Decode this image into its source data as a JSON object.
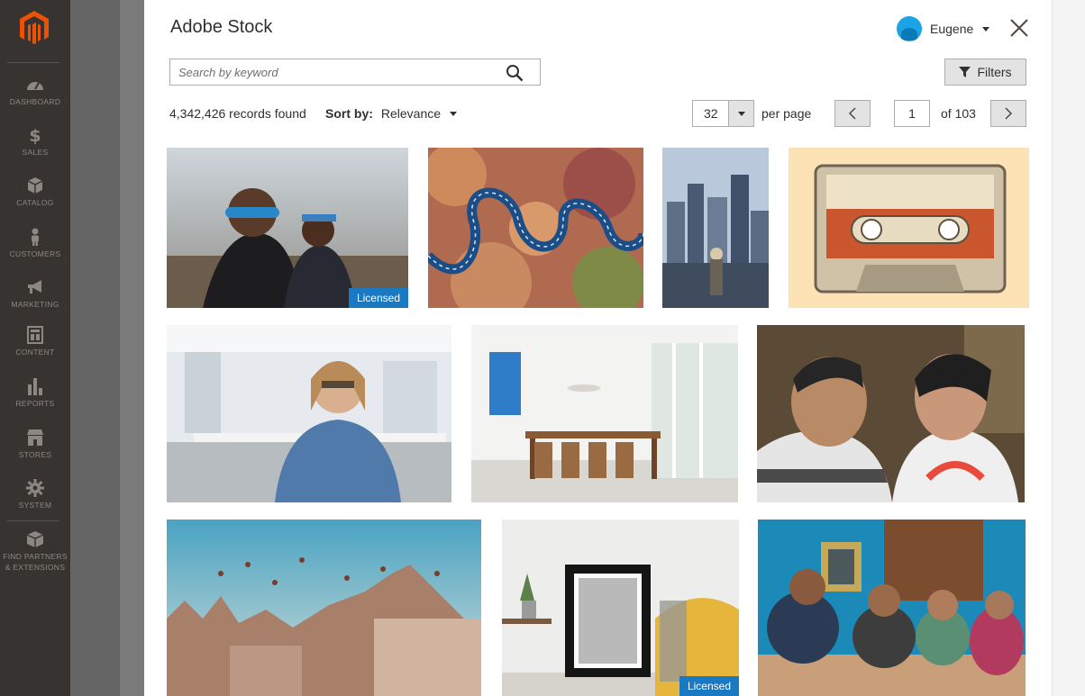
{
  "admin_nav": {
    "items": [
      {
        "label": "DASHBOARD",
        "icon": "dashboard-icon"
      },
      {
        "label": "SALES",
        "icon": "dollar-icon"
      },
      {
        "label": "CATALOG",
        "icon": "box-icon"
      },
      {
        "label": "CUSTOMERS",
        "icon": "person-icon"
      },
      {
        "label": "MARKETING",
        "icon": "megaphone-icon"
      },
      {
        "label": "CONTENT",
        "icon": "layout-icon"
      },
      {
        "label": "REPORTS",
        "icon": "bar-chart-icon"
      },
      {
        "label": "STORES",
        "icon": "storefront-icon"
      },
      {
        "label": "SYSTEM",
        "icon": "gear-icon"
      },
      {
        "label_line1": "FIND PARTNERS",
        "label_line2": "& EXTENSIONS",
        "icon": "package-icon"
      }
    ]
  },
  "modal": {
    "title": "Adobe Stock",
    "user_name": "Eugene",
    "search_placeholder": "Search by keyword",
    "filters_label": "Filters",
    "records_found": "4,342,426 records found",
    "sort_label": "Sort by:",
    "sort_value": "Relevance",
    "per_page_value": "32",
    "per_page_label": "per page",
    "current_page": "1",
    "total_pages": "of 103",
    "licensed_label": "Licensed"
  },
  "colors": {
    "sidebar": "#373330",
    "accent": "#1979c3",
    "button_bg": "#e3e3e3"
  }
}
